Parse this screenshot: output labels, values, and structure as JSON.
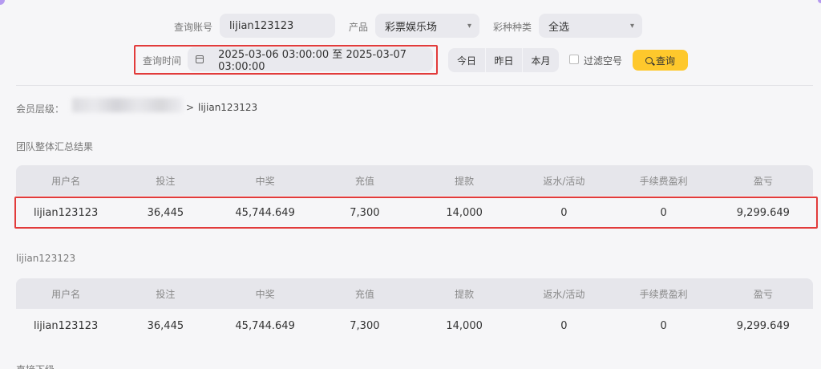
{
  "filters": {
    "account_label": "查询账号",
    "account_value": "lijian123123",
    "product_label": "产品",
    "product_value": "彩票娱乐场",
    "lottery_label": "彩种种类",
    "lottery_value": "全选",
    "time_label": "查询时间",
    "time_range": "2025-03-06 03:00:00 至 2025-03-07 03:00:00",
    "today": "今日",
    "yesterday": "昨日",
    "this_month": "本月",
    "filter_empty_label": "过滤空号",
    "query_button": "查询"
  },
  "breadcrumb": {
    "label": "会员层级：",
    "separator": ">",
    "current": "lijian123123"
  },
  "team_summary": {
    "title": "团队整体汇总结果",
    "columns": [
      "用户名",
      "投注",
      "中奖",
      "充值",
      "提款",
      "返水/活动",
      "手续费盈利",
      "盈亏"
    ],
    "rows": [
      [
        "lijian123123",
        "36,445",
        "45,744.649",
        "7,300",
        "14,000",
        "0",
        "0",
        "9,299.649"
      ]
    ]
  },
  "member_table": {
    "title": "lijian123123",
    "columns": [
      "用户名",
      "投注",
      "中奖",
      "充值",
      "提款",
      "返水/活动",
      "手续费盈利",
      "盈亏"
    ],
    "rows": [
      [
        "lijian123123",
        "36,445",
        "45,744.649",
        "7,300",
        "14,000",
        "0",
        "0",
        "9,299.649"
      ]
    ]
  },
  "next_section_title": "直接下级",
  "colors": {
    "accent": "#fec82c",
    "highlight": "#e23b3b",
    "corner": "#b59af0"
  }
}
